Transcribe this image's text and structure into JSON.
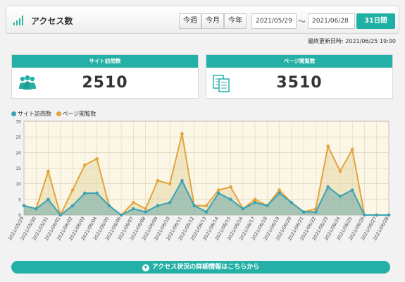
{
  "header": {
    "title": "アクセス数",
    "period_buttons": [
      "今週",
      "今月",
      "今年"
    ],
    "date_from": "2021/05/29",
    "separator": "〜",
    "date_to": "2021/06/28",
    "days_badge": "31日間"
  },
  "updated_text": "最終更新日時: 2021/06/25 19:00",
  "cards": {
    "visits": {
      "title": "サイト訪問数",
      "value": "2510"
    },
    "pageviews": {
      "title": "ページ閲覧数",
      "value": "3510"
    }
  },
  "legend": {
    "visits": "サイト訪問数",
    "pageviews": "ページ閲覧数"
  },
  "colors": {
    "accent": "#24b0a6",
    "visits": "#3aa3b3",
    "pageviews": "#e3a33a",
    "plot_bg": "#fbf6e6"
  },
  "chart_data": {
    "type": "line",
    "x": [
      "2021/05/29",
      "2021/05/30",
      "2021/05/31",
      "2021/06/01",
      "2021/06/02",
      "2021/06/03",
      "2021/06/04",
      "2021/06/05",
      "2021/06/06",
      "2021/06/07",
      "2021/06/08",
      "2021/06/09",
      "2021/06/10",
      "2021/06/11",
      "2021/06/12",
      "2021/06/13",
      "2021/06/14",
      "2021/06/15",
      "2021/06/16",
      "2021/06/17",
      "2021/06/18",
      "2021/06/19",
      "2021/06/20",
      "2021/06/21",
      "2021/06/22",
      "2021/06/23",
      "2021/06/24",
      "2021/06/25",
      "2021/06/26",
      "2021/06/27",
      "2021/06/28"
    ],
    "series": [
      {
        "name": "サイト訪問数",
        "values": [
          3,
          2,
          5,
          0,
          3,
          7,
          7,
          3,
          0,
          2,
          1,
          3,
          4,
          11,
          3,
          1,
          7,
          5,
          2,
          4,
          3,
          7,
          4,
          1,
          1,
          9,
          6,
          8,
          0,
          0,
          0
        ]
      },
      {
        "name": "ページ閲覧数",
        "values": [
          3,
          2,
          14,
          0,
          8,
          16,
          18,
          3,
          0,
          4,
          2,
          11,
          10,
          26,
          3,
          3,
          8,
          9,
          2,
          5,
          3,
          8,
          4,
          1,
          2,
          22,
          14,
          21,
          0,
          0,
          0
        ]
      }
    ],
    "yticks": [
      0,
      5,
      10,
      15,
      20,
      25,
      30
    ],
    "ylim": [
      0,
      30
    ],
    "grid": true,
    "legend_position": "top-left"
  },
  "detail_button": {
    "label": "アクセス状況の詳細情報はこちらから"
  }
}
